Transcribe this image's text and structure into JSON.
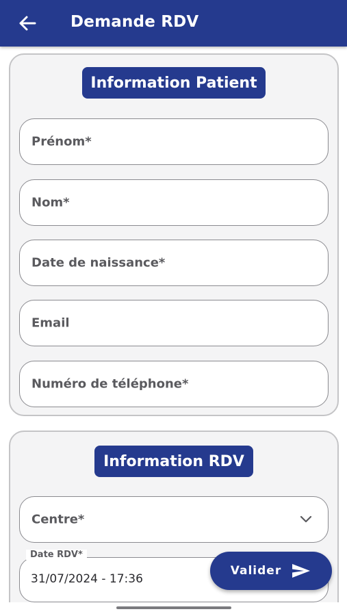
{
  "appbar": {
    "title": "Demande RDV",
    "back_icon": "arrow-left-icon",
    "color": "#253a8e"
  },
  "patient_section": {
    "title": "Information Patient",
    "fields": {
      "first_name": "Prénom*",
      "last_name": "Nom*",
      "birth_date": "Date de naissance*",
      "email": "Email",
      "phone": "Numéro de téléphone*"
    }
  },
  "rdv_section": {
    "title": "Information RDV",
    "centre_label": "Centre*",
    "centre_icon": "chevron-down-icon",
    "date_label": "Date RDV*",
    "date_value": "31/07/2024 - 17:36"
  },
  "fab": {
    "label": "Valider",
    "icon": "send-icon"
  }
}
